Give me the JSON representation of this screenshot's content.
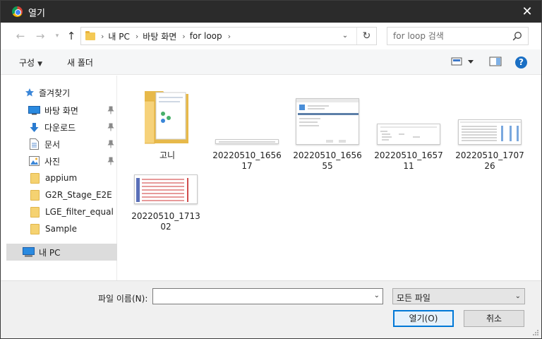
{
  "window": {
    "title": "열기"
  },
  "nav": {
    "breadcrumbs": [
      "내 PC",
      "바탕 화면",
      "for loop"
    ]
  },
  "search": {
    "placeholder": "for loop 검색"
  },
  "toolbar": {
    "organize": "구성",
    "new_folder": "새 폴더"
  },
  "sidebar": {
    "items": [
      {
        "label": "즐겨찾기",
        "icon": "star-icon"
      },
      {
        "label": "바탕 화면",
        "icon": "desktop-icon",
        "pinned": true
      },
      {
        "label": "다운로드",
        "icon": "download-icon",
        "pinned": true
      },
      {
        "label": "문서",
        "icon": "document-icon",
        "pinned": true
      },
      {
        "label": "사진",
        "icon": "pictures-icon",
        "pinned": true
      },
      {
        "label": "appium",
        "icon": "folder-icon"
      },
      {
        "label": "G2R_Stage_E2E",
        "icon": "folder-icon"
      },
      {
        "label": "LGE_filter_equal",
        "icon": "folder-icon"
      },
      {
        "label": "Sample",
        "icon": "folder-icon"
      },
      {
        "label": "내 PC",
        "icon": "pc-icon",
        "selected": true
      }
    ]
  },
  "files": [
    {
      "name": "고니",
      "kind": "folder"
    },
    {
      "name": "20220510_165617",
      "kind": "image"
    },
    {
      "name": "20220510_165655",
      "kind": "image"
    },
    {
      "name": "20220510_165711",
      "kind": "image"
    },
    {
      "name": "20220510_170726",
      "kind": "image"
    },
    {
      "name": "20220510_171302",
      "kind": "image"
    }
  ],
  "footer": {
    "filename_label": "파일 이름(N):",
    "filename_value": "",
    "filetype": "모든 파일",
    "open_label": "열기(O)",
    "cancel_label": "취소"
  },
  "colors": {
    "accent": "#0078d7",
    "titlebar": "#2b2b2b",
    "help": "#1a6fc4"
  }
}
